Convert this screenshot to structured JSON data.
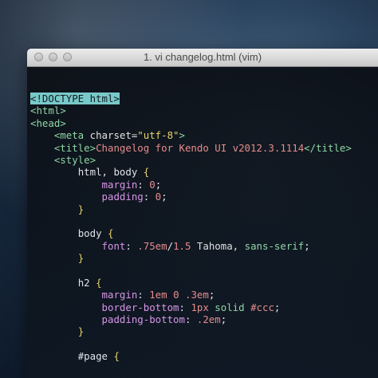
{
  "window": {
    "title": "1. vi changelog.html (vim)"
  },
  "editor": {
    "lines": [
      [
        {
          "t": "<!DOCTYPE html>",
          "c": "doctype-hl"
        }
      ],
      [
        {
          "t": "<html>",
          "c": "tag"
        }
      ],
      [
        {
          "t": "<head>",
          "c": "tag"
        }
      ],
      [
        {
          "t": "    ",
          "c": "punc"
        },
        {
          "t": "<meta ",
          "c": "tag"
        },
        {
          "t": "charset",
          "c": "attr"
        },
        {
          "t": "=",
          "c": "punc"
        },
        {
          "t": "\"utf-8\"",
          "c": "str"
        },
        {
          "t": ">",
          "c": "tag"
        }
      ],
      [
        {
          "t": "    ",
          "c": "punc"
        },
        {
          "t": "<title>",
          "c": "tag"
        },
        {
          "t": "Changelog for Kendo UI v2012.3.1114",
          "c": "txt"
        },
        {
          "t": "</title>",
          "c": "tag"
        }
      ],
      [
        {
          "t": "    ",
          "c": "punc"
        },
        {
          "t": "<style>",
          "c": "tag"
        }
      ],
      [
        {
          "t": "        ",
          "c": "punc"
        },
        {
          "t": "html, body ",
          "c": "punc"
        },
        {
          "t": "{",
          "c": "sel"
        }
      ],
      [
        {
          "t": "            ",
          "c": "punc"
        },
        {
          "t": "margin",
          "c": "prop"
        },
        {
          "t": ": ",
          "c": "punc"
        },
        {
          "t": "0",
          "c": "num"
        },
        {
          "t": ";",
          "c": "punc"
        }
      ],
      [
        {
          "t": "            ",
          "c": "punc"
        },
        {
          "t": "padding",
          "c": "prop"
        },
        {
          "t": ": ",
          "c": "punc"
        },
        {
          "t": "0",
          "c": "num"
        },
        {
          "t": ";",
          "c": "punc"
        }
      ],
      [
        {
          "t": "        ",
          "c": "punc"
        },
        {
          "t": "}",
          "c": "sel"
        }
      ],
      [],
      [
        {
          "t": "        ",
          "c": "punc"
        },
        {
          "t": "body ",
          "c": "punc"
        },
        {
          "t": "{",
          "c": "sel"
        }
      ],
      [
        {
          "t": "            ",
          "c": "punc"
        },
        {
          "t": "font",
          "c": "prop"
        },
        {
          "t": ": ",
          "c": "punc"
        },
        {
          "t": ".75em",
          "c": "num"
        },
        {
          "t": "/",
          "c": "punc"
        },
        {
          "t": "1.5",
          "c": "num"
        },
        {
          "t": " Tahoma, ",
          "c": "val"
        },
        {
          "t": "sans-serif",
          "c": "kw"
        },
        {
          "t": ";",
          "c": "punc"
        }
      ],
      [
        {
          "t": "        ",
          "c": "punc"
        },
        {
          "t": "}",
          "c": "sel"
        }
      ],
      [],
      [
        {
          "t": "        ",
          "c": "punc"
        },
        {
          "t": "h2 ",
          "c": "punc"
        },
        {
          "t": "{",
          "c": "sel"
        }
      ],
      [
        {
          "t": "            ",
          "c": "punc"
        },
        {
          "t": "margin",
          "c": "prop"
        },
        {
          "t": ": ",
          "c": "punc"
        },
        {
          "t": "1em",
          "c": "num"
        },
        {
          "t": " ",
          "c": "punc"
        },
        {
          "t": "0",
          "c": "num"
        },
        {
          "t": " ",
          "c": "punc"
        },
        {
          "t": ".3em",
          "c": "num"
        },
        {
          "t": ";",
          "c": "punc"
        }
      ],
      [
        {
          "t": "            ",
          "c": "punc"
        },
        {
          "t": "border-bottom",
          "c": "prop"
        },
        {
          "t": ": ",
          "c": "punc"
        },
        {
          "t": "1px",
          "c": "num"
        },
        {
          "t": " ",
          "c": "punc"
        },
        {
          "t": "solid",
          "c": "kw"
        },
        {
          "t": " ",
          "c": "punc"
        },
        {
          "t": "#ccc",
          "c": "num"
        },
        {
          "t": ";",
          "c": "punc"
        }
      ],
      [
        {
          "t": "            ",
          "c": "punc"
        },
        {
          "t": "padding-bottom",
          "c": "prop"
        },
        {
          "t": ": ",
          "c": "punc"
        },
        {
          "t": ".2em",
          "c": "num"
        },
        {
          "t": ";",
          "c": "punc"
        }
      ],
      [
        {
          "t": "        ",
          "c": "punc"
        },
        {
          "t": "}",
          "c": "sel"
        }
      ],
      [],
      [
        {
          "t": "        ",
          "c": "punc"
        },
        {
          "t": "#page ",
          "c": "punc"
        },
        {
          "t": "{",
          "c": "sel"
        }
      ]
    ]
  }
}
